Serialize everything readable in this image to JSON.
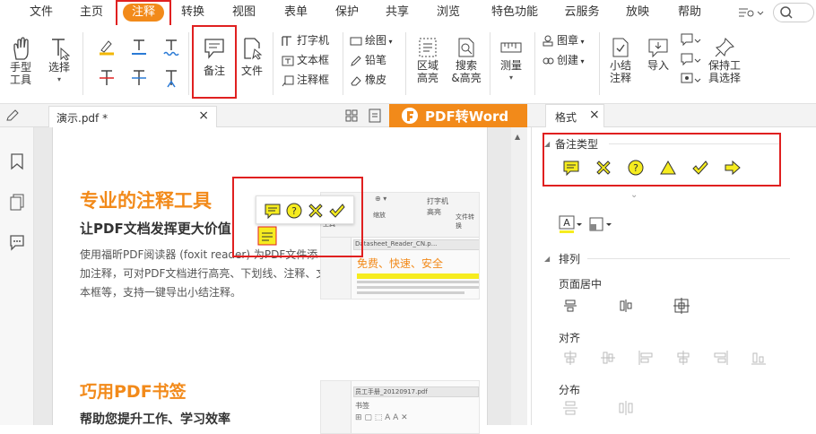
{
  "menu": {
    "items": [
      "文件",
      "主页",
      "注释",
      "转换",
      "视图",
      "表单",
      "保护",
      "共享",
      "浏览",
      "特色功能",
      "云服务",
      "放映",
      "帮助"
    ]
  },
  "ribbon": {
    "hand": "手型\n工具",
    "hand_l1": "手型",
    "hand_l2": "工具",
    "select_l1": "选择",
    "note_label": "备注",
    "file_label": "文件",
    "typewriter": "打字机",
    "textbox": "文本框",
    "callout": "注释框",
    "draw": "绘图",
    "pencil": "铅笔",
    "eraser": "橡皮",
    "area_l1": "区域",
    "area_l2": "高亮",
    "search_l1": "搜索",
    "search_l2": "&高亮",
    "measure": "测量",
    "stamp": "图章",
    "create": "创建",
    "summary_l1": "小结",
    "summary_l2": "注释",
    "import": "导入",
    "keep_l1": "保持工",
    "keep_l2": "具选择"
  },
  "tabs": {
    "doc_tab": "演示.pdf *",
    "banner": "PDF转Word",
    "format_tab": "格式"
  },
  "doc": {
    "h1": "专业的注释工具",
    "h1_sub": "让PDF文档发挥更大价值",
    "p1": "使用福昕PDF阅读器 (foxit reader) 为PDF文件添加注释，可对PDF文档进行高亮、下划线、注释、文本框等，支持一键导出小结注释。",
    "p1_l1": "使用福昕PDF阅读器 (foxit reader) 为PDF文件添",
    "p1_l2": "加注释，可对PDF文档进行高亮、下划线、注释、文",
    "p1_l3": "本框等，支持一键导出小结注释。",
    "thumb1_tab": "Datasheet_Reader_CN.p...",
    "thumb1_title": "免费、快速、安全",
    "thumb1_tools": [
      "工具",
      "缩放",
      "打字机",
      "高亮",
      "文件转换"
    ],
    "h2": "巧用PDF书签",
    "h2_sub": "帮助您提升工作、学习效率",
    "thumb2_tab": "员工手册_20120917.pdf",
    "thumb2_bm": "书签"
  },
  "rpanel": {
    "section_note_type": "备注类型",
    "section_arrange": "排列",
    "page_center": "页面居中",
    "align": "对齐",
    "distribute": "分布"
  },
  "colors": {
    "accent": "#f28a1a",
    "highlight_red": "#e02020",
    "note_yellow": "#f6ec1f"
  }
}
